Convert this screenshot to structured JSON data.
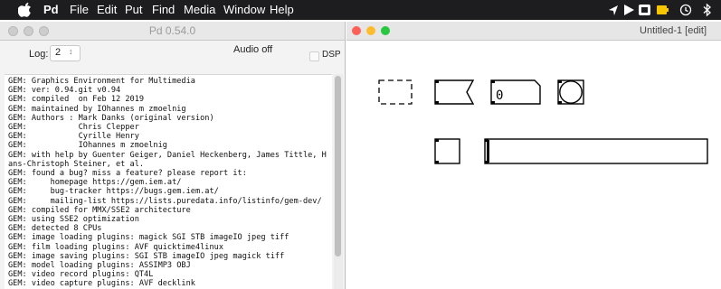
{
  "menubar": {
    "app_name": "Pd",
    "menus": [
      "File",
      "Edit",
      "Put",
      "Find",
      "Media",
      "Window",
      "Help"
    ]
  },
  "pd_window": {
    "title": "Pd 0.54.0",
    "log_label": "Log:",
    "log_level": "2",
    "audio_status": "Audio off",
    "dsp_label": "DSP",
    "console_lines": [
      "GEM: Graphics Environment for Multimedia",
      "GEM: ver: 0.94.git v0.94",
      "GEM: compiled  on Feb 12 2019",
      "GEM: maintained by IOhannes m zmoelnig",
      "GEM: Authors : Mark Danks (original version)",
      "GEM:           Chris Clepper",
      "GEM:           Cyrille Henry",
      "GEM:           IOhannes m zmoelnig",
      "GEM: with help by Guenter Geiger, Daniel Heckenberg, James Tittle, H",
      "ans-Christoph Steiner, et al.",
      "GEM: found a bug? miss a feature? please report it:",
      "GEM:     homepage https://gem.iem.at/",
      "GEM:     bug-tracker https://bugs.gem.iem.at/",
      "GEM:     mailing-list https://lists.puredata.info/listinfo/gem-dev/",
      "GEM: compiled for MMX/SSE2 architecture",
      "GEM: using SSE2 optimization",
      "GEM: detected 8 CPUs",
      "GEM: image loading plugins: magick SGI STB imageIO jpeg tiff",
      "GEM: film loading plugins: AVF quicktime4linux",
      "GEM: image saving plugins: SGI STB imageIO jpeg magick tiff",
      "GEM: model loading plugins: ASSIMP3 OBJ",
      "GEM: video record plugins: QT4L",
      "GEM: video capture plugins: AVF decklink"
    ]
  },
  "patch_window": {
    "title": "Untitled-1 [edit]",
    "number_box_value": "0"
  },
  "colors": {
    "menubar_bg": "#1d1d1f",
    "traffic_red": "#fe5f57",
    "traffic_yellow": "#febc2e",
    "traffic_green": "#28c840"
  },
  "icons": [
    "apple-icon",
    "location-arrow-icon",
    "play-icon",
    "display-icon",
    "battery-icon",
    "time-machine-icon",
    "bluetooth-icon"
  ]
}
